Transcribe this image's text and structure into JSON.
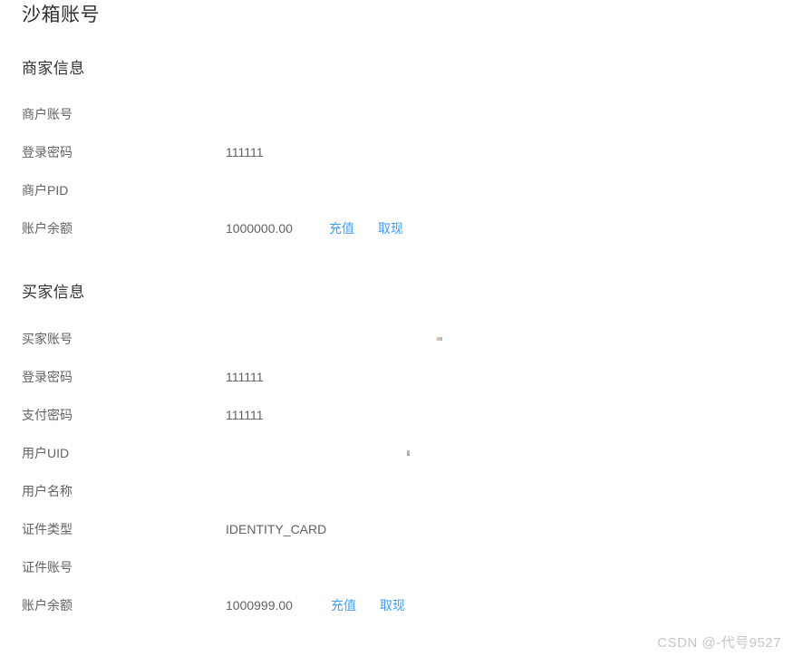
{
  "page": {
    "title": "沙箱账号",
    "watermark": "CSDN @-代号9527"
  },
  "colors": {
    "link": "#409eff",
    "label": "#606266",
    "value": "#606266",
    "heading": "#303133",
    "background": "#ffffff",
    "watermark": "#c6c6c6"
  },
  "merchant_section": {
    "title": "商家信息",
    "rows": [
      {
        "label": "商户账号",
        "value": ""
      },
      {
        "label": "登录密码",
        "value": "111111"
      },
      {
        "label": "商户PID",
        "value": ""
      },
      {
        "label": "账户余额",
        "value": "1000000.00",
        "actions": [
          {
            "label": "充值",
            "name": "recharge"
          },
          {
            "label": "取现",
            "name": "withdraw"
          }
        ]
      }
    ]
  },
  "buyer_section": {
    "title": "买家信息",
    "rows": [
      {
        "label": "买家账号",
        "value": ""
      },
      {
        "label": "登录密码",
        "value": "111111"
      },
      {
        "label": "支付密码",
        "value": "111111"
      },
      {
        "label": "用户UID",
        "value": ""
      },
      {
        "label": "用户名称",
        "value": ""
      },
      {
        "label": "证件类型",
        "value": "IDENTITY_CARD"
      },
      {
        "label": "证件账号",
        "value": ""
      },
      {
        "label": "账户余额",
        "value": "1000999.00",
        "actions": [
          {
            "label": "充值",
            "name": "recharge"
          },
          {
            "label": "取现",
            "name": "withdraw"
          }
        ]
      }
    ]
  }
}
